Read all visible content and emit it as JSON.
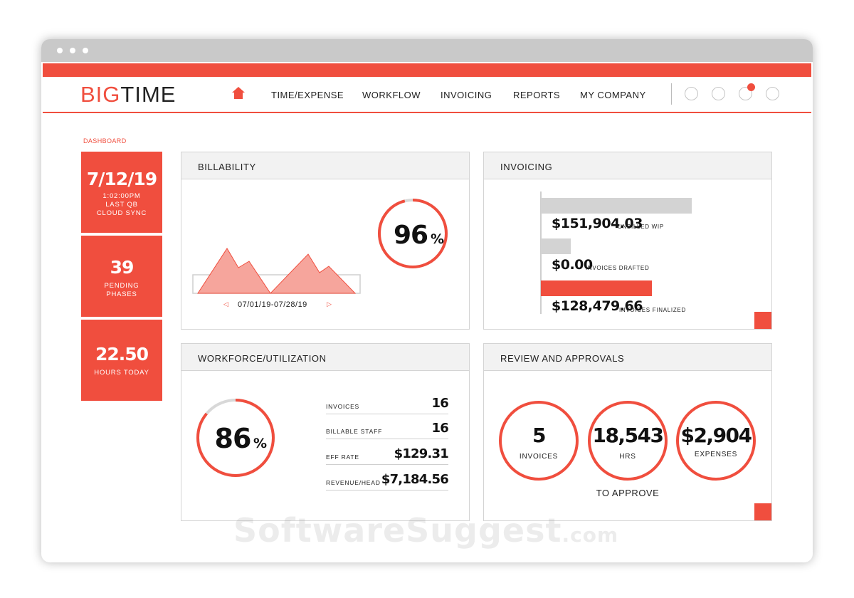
{
  "brand": {
    "logo_part1": "BIG",
    "logo_part2": "TIME",
    "accent_color": "#f04e3e"
  },
  "nav": {
    "items": [
      {
        "label": "TIME/EXPENSE"
      },
      {
        "label": "WORKFLOW"
      },
      {
        "label": "INVOICING"
      },
      {
        "label": "REPORTS"
      },
      {
        "label": "MY COMPANY"
      }
    ],
    "icons": [
      "home-icon",
      "user-circle-icon",
      "settings-circle-icon",
      "notification-circle-icon",
      "help-circle-icon"
    ]
  },
  "breadcrumb": "DASHBOARD",
  "sidebar_stats": [
    {
      "value": "7/12/19",
      "lines": [
        "1:02:00PM",
        "LAST QB",
        "CLOUD SYNC"
      ]
    },
    {
      "value": "39",
      "lines": [
        "PENDING",
        "PHASES"
      ]
    },
    {
      "value": "22.50",
      "lines": [
        "HOURS TODAY"
      ]
    }
  ],
  "billability": {
    "title": "BILLABILITY",
    "percent_value": "96",
    "percent_sign": "%",
    "percent_fraction": 0.96,
    "date_range": "07/01/19-07/28/19",
    "prev_icon": "caret-left-icon",
    "next_icon": "caret-right-icon"
  },
  "invoicing": {
    "title": "INVOICING",
    "bars": [
      {
        "amount": "$151,904.03",
        "label": "UNBILLED WIP",
        "fraction": 0.2,
        "color": "#d3d3d3"
      },
      {
        "amount": "$0.00",
        "label": "INVOICES DRAFTED",
        "fraction": 0.2,
        "color": "#d3d3d3"
      },
      {
        "amount": "$128,479.66",
        "label": "INVOICES FINALIZED",
        "fraction": 0.2,
        "color": "#f04e3e"
      }
    ]
  },
  "workforce": {
    "title": "WORKFORCE/UTILIZATION",
    "percent_value": "86",
    "percent_sign": "%",
    "percent_fraction": 0.86,
    "rows": [
      {
        "label": "INVOICES",
        "value": "16"
      },
      {
        "label": "BILLABLE STAFF",
        "value": "16"
      },
      {
        "label": "EFF RATE",
        "value": "$129.31"
      },
      {
        "label": "REVENUE/HEAD",
        "value": "$7,184.56"
      }
    ]
  },
  "review": {
    "title": "REVIEW AND APPROVALS",
    "items": [
      {
        "value": "5",
        "label": "INVOICES"
      },
      {
        "value": "18,543",
        "label": "HRS"
      },
      {
        "value": "$2,904",
        "label": "EXPENSES"
      }
    ],
    "footer": "TO APPROVE"
  },
  "watermark": {
    "main": "SoftwareSuggest",
    "tld": ".com"
  }
}
